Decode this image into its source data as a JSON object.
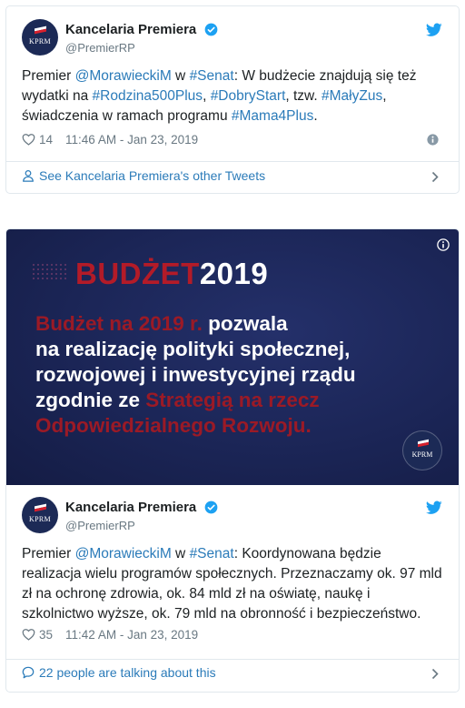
{
  "colors": {
    "link": "#2b7bb9",
    "muted": "#697882",
    "border": "#e1e8ed",
    "brand_red": "#b31b28",
    "navy": "#1b2556"
  },
  "tweet1": {
    "author": {
      "name": "Kancelaria Premiera",
      "handle": "@PremierRP",
      "avatar_text": "KPRM"
    },
    "text": {
      "p1": "Premier ",
      "m1": "@MorawieckiM",
      "p2": " w ",
      "h1": "#Senat",
      "p3": ": W budżecie znajdują się też wydatki na ",
      "h2": "#Rodzina500Plus",
      "p4": ", ",
      "h3": "#DobryStart",
      "p5": ", tzw. ",
      "h4": "#MałyZus",
      "p6": ", świadczenia w ramach programu ",
      "h5": "#Mama4Plus",
      "p7": "."
    },
    "likes": "14",
    "timestamp": "11:46 AM - Jan 23, 2019",
    "footer": "See Kancelaria Premiera's other Tweets"
  },
  "tweet2": {
    "media": {
      "title_red": "BUDŻET",
      "title_white": "2019",
      "line1_red": "Budżet na 2019 r.",
      "line1_white": " pozwala",
      "line2": "na realizację polityki społecznej,",
      "line3": "rozwojowej i inwestycyjnej rządu",
      "line4_white": "zgodnie ze ",
      "line4_red": "Strategią na rzecz",
      "line5_red": "Odpowiedzialnego Rozwoju.",
      "logo_text": "KPRM"
    },
    "author": {
      "name": "Kancelaria Premiera",
      "handle": "@PremierRP",
      "avatar_text": "KPRM"
    },
    "text": {
      "p1": "Premier ",
      "m1": "@MorawieckiM",
      "p2": " w ",
      "h1": "#Senat",
      "p3": ": Koordynowana będzie realizacja wielu programów społecznych. Przeznaczamy ok. 97 mld zł na ochronę zdrowia, ok. 84 mld zł na oświatę, naukę i szkolnictwo wyższe, ok. 79 mld na obronność i bezpieczeństwo."
    },
    "likes": "35",
    "timestamp": "11:42 AM - Jan 23, 2019",
    "footer": "22 people are talking about this"
  }
}
